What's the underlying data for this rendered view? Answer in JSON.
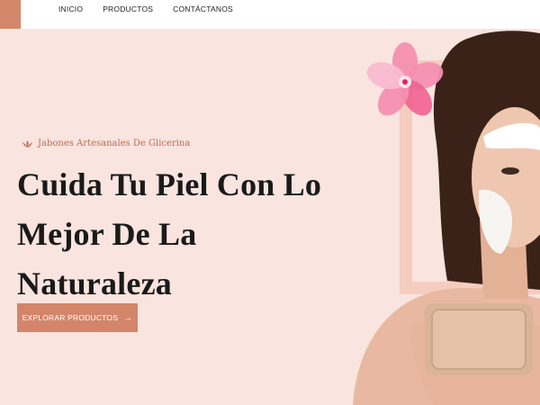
{
  "nav": {
    "items": [
      "INICIO",
      "PRODUCTOS",
      "CONTÁCTANOS"
    ]
  },
  "hero": {
    "tagline": "Jabones Artesanales De Glicerina",
    "headline_lines": [
      "Cuida Tu Piel Con Lo",
      "Mejor De La",
      "Naturaleza"
    ],
    "cta_label": "EXPLORAR PRODUCTOS"
  },
  "colors": {
    "background": "#f9e4df",
    "accent": "#d3856a",
    "frame": "#f4cdbf",
    "text": "#1a1a1a"
  },
  "icons": {
    "tagline_icon": "lotus-icon",
    "cta_icon": "arrow-right-icon"
  }
}
